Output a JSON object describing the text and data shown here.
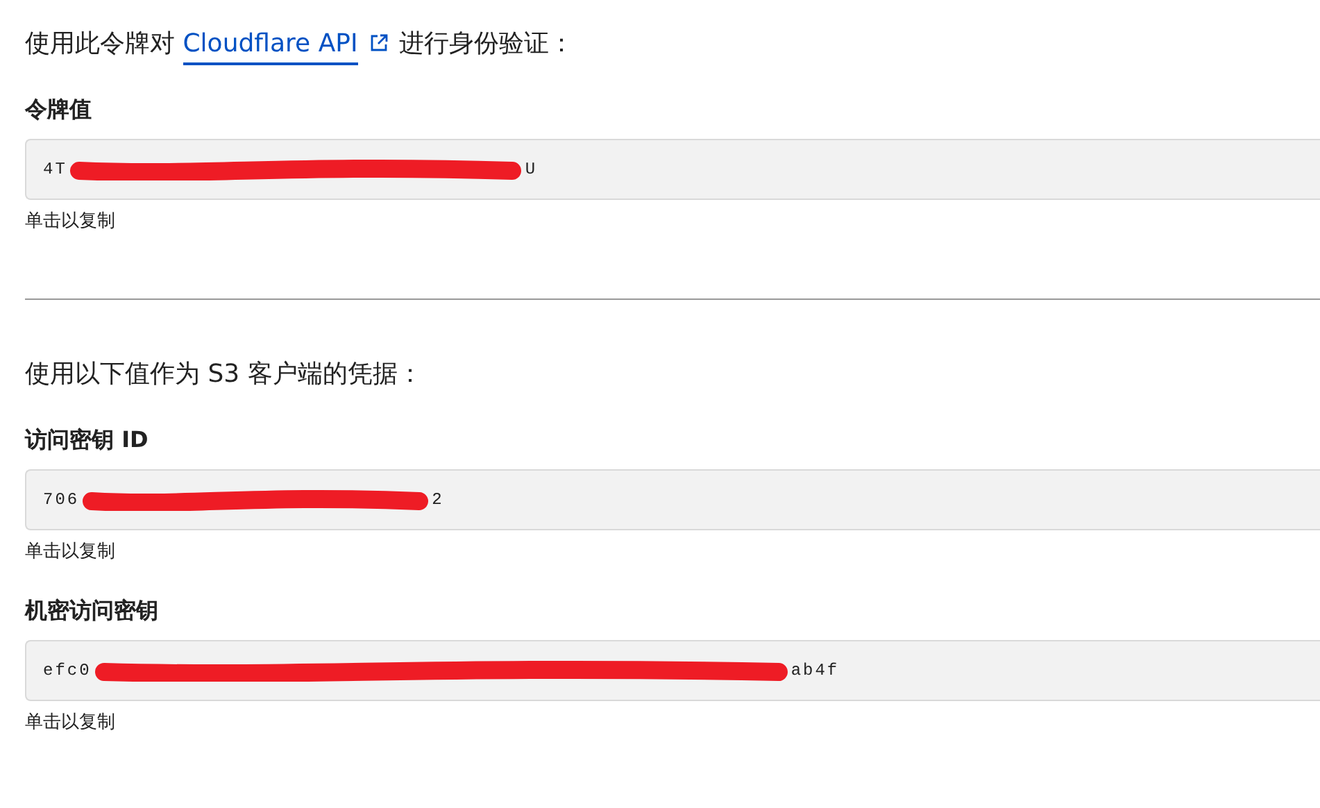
{
  "intro": {
    "before": "使用此令牌对 ",
    "link": "Cloudflare API",
    "after": " 进行身份验证："
  },
  "token_field": {
    "label": "令牌值",
    "value_start": "4T",
    "value_end": "U",
    "redacted": true,
    "hint": "单击以复制"
  },
  "s3_intro": "使用以下值作为 S3 客户端的凭据：",
  "s3_fields": [
    {
      "label": "访问密钥 ID",
      "value_start": "706",
      "value_end": "2",
      "redacted": true,
      "hint": "单击以复制"
    },
    {
      "label": "机密访问密钥",
      "value_start": "efc0",
      "value_end": "ab4f",
      "redacted": true,
      "hint": "单击以复制"
    }
  ]
}
